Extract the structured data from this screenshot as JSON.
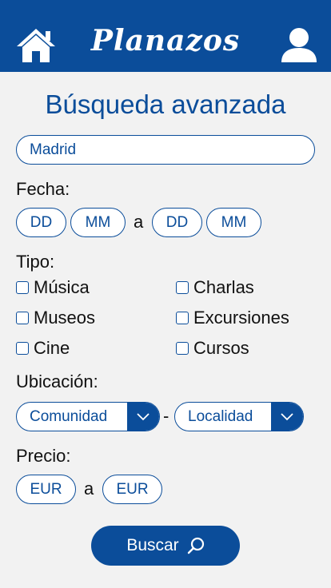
{
  "header": {
    "logo_text": "Planazos",
    "home_icon": "home-icon",
    "user_icon": "user-icon"
  },
  "page": {
    "title": "Búsqueda avanzada"
  },
  "search": {
    "city_value": "Madrid"
  },
  "fecha": {
    "label": "Fecha:",
    "from_day": "DD",
    "from_month": "MM",
    "separator": "a",
    "to_day": "DD",
    "to_month": "MM"
  },
  "tipo": {
    "label": "Tipo:",
    "options": [
      "Música",
      "Charlas",
      "Museos",
      "Excursiones",
      "Cine",
      "Cursos"
    ]
  },
  "ubicacion": {
    "label": "Ubicación:",
    "comunidad": "Comunidad",
    "separator": "-",
    "localidad": "Localidad"
  },
  "precio": {
    "label": "Precio:",
    "min_currency": "EUR",
    "separator": "a",
    "max_currency": "EUR"
  },
  "actions": {
    "search_label": "Buscar"
  },
  "colors": {
    "brand": "#0b4d9a",
    "background": "#f2f2f2"
  }
}
